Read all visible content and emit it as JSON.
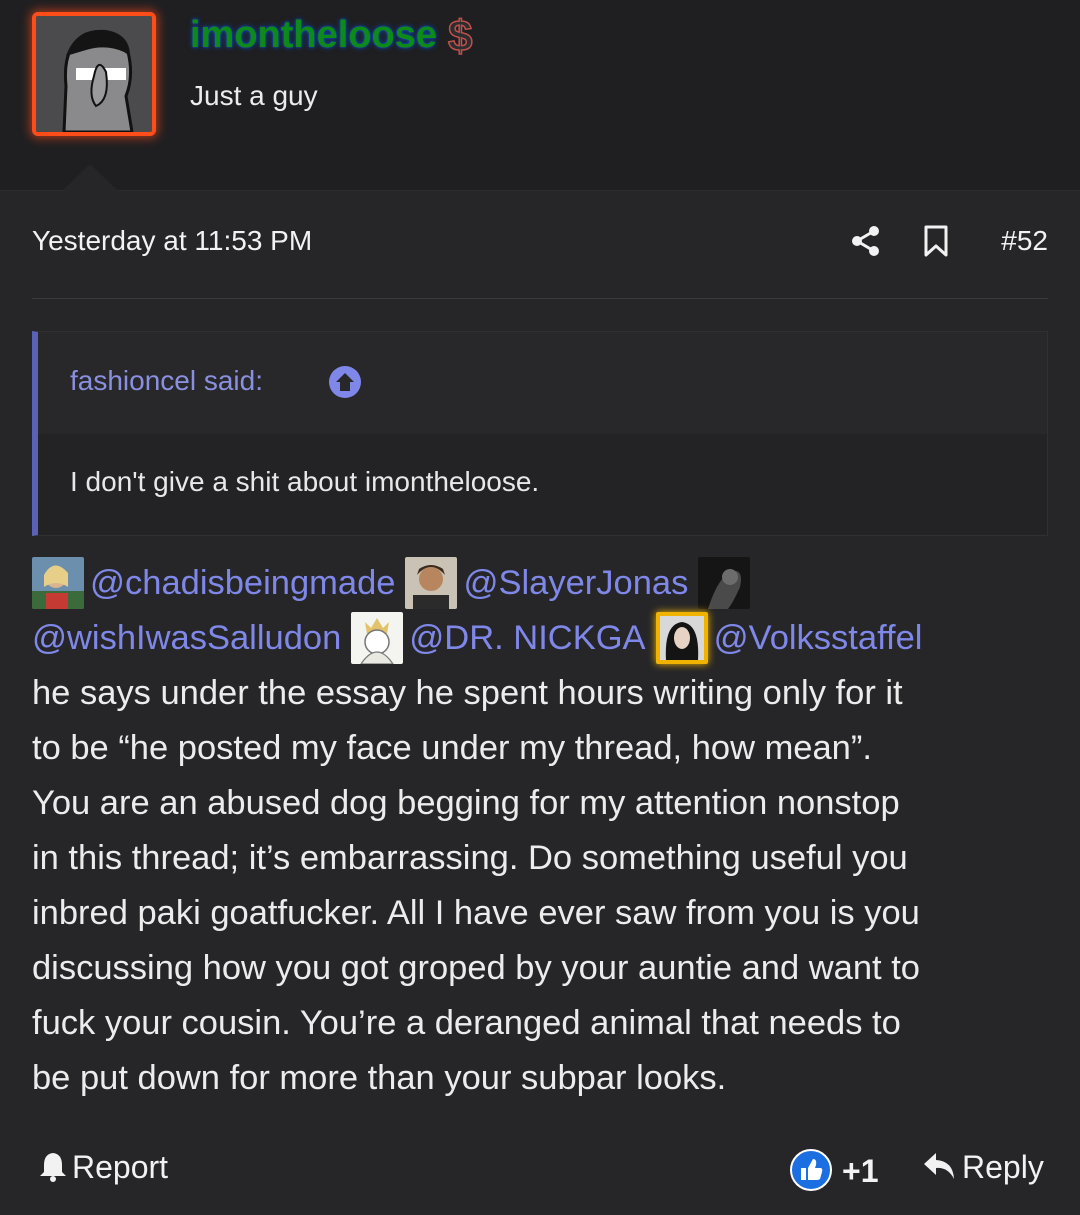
{
  "user": {
    "name": "imontheloose",
    "title": "Just a guy",
    "badge_icon": "dollar-sign-icon"
  },
  "post": {
    "timestamp": "Yesterday at 11:53 PM",
    "number": "#52",
    "quote": {
      "author": "fashioncel said:",
      "text": "I don't give a shit about imontheloose."
    },
    "mentions": {
      "m1": "@chadisbeingmade",
      "m2": "@SlayerJonas",
      "m3": "@wishIwasSalludon",
      "m4": "@DR. NICKGA",
      "m5": "@Volksstaffel"
    },
    "lines": [
      "he says under the essay he spent hours writing only for it",
      "to be “he posted my face under my thread, how mean”.",
      "You are an abused dog begging for my attention nonstop",
      "in this thread; it’s embarrassing. Do something useful you",
      "inbred paki goatfucker. All I have ever saw from you is you",
      "discussing how you got groped by your auntie and want to",
      "fuck your cousin. You’re a deranged animal that needs to",
      "be put down for more than your subpar looks."
    ],
    "footer": {
      "report_label": "Report",
      "like_count": "+1",
      "reply_label": "Reply"
    }
  },
  "colors": {
    "accent_link": "#7f88e8",
    "quote_bar": "#5a62b8",
    "avatar_border": "#ff4d1a",
    "username": "#0d8a1a"
  }
}
